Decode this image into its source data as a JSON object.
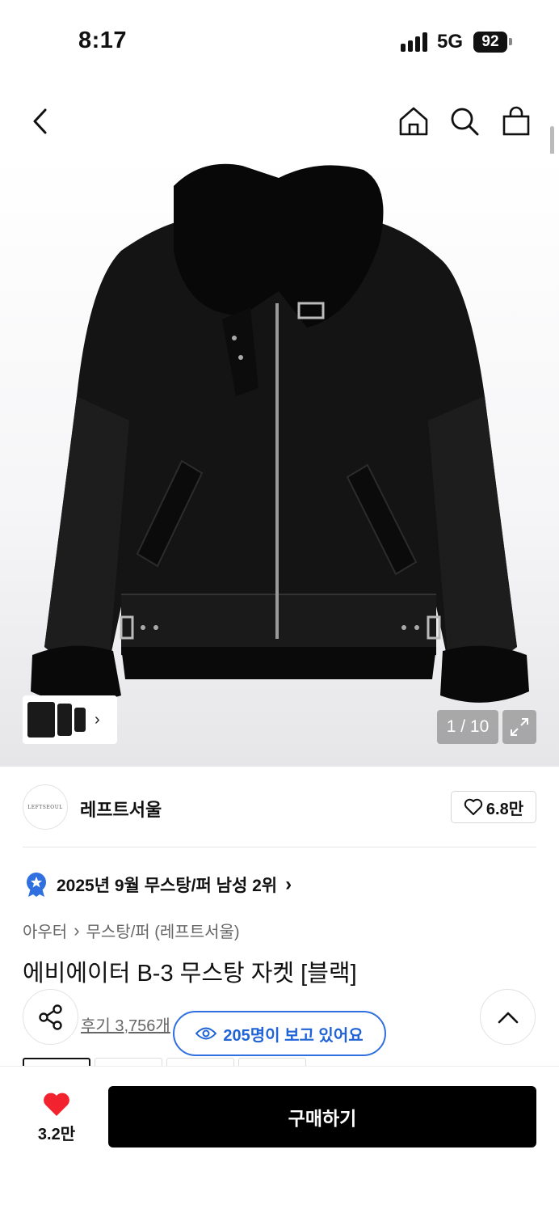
{
  "status": {
    "time": "8:17",
    "network": "5G",
    "battery": "92"
  },
  "nav": {
    "back_icon": "chevron-left-icon",
    "home_icon": "home-icon",
    "search_icon": "search-icon",
    "cart_icon": "shopping-bag-icon"
  },
  "gallery": {
    "counter": "1 / 10",
    "thumb_chevron": "›"
  },
  "brand": {
    "logo_text": "LEFTSEOUL",
    "name": "레프트서울",
    "likes": "6.8만"
  },
  "ranking": {
    "text": "2025년 9월 무스탕/퍼 남성 2위",
    "chevron": "›"
  },
  "breadcrumb": {
    "category": "아우터",
    "separator": "›",
    "subcategory": "무스탕/퍼 (레프트서울)"
  },
  "product": {
    "title": "에비에이터 B-3 무스탕 자켓 [블랙]",
    "reviews": "후기 3,756개"
  },
  "viewers": {
    "text": "205명이 보고 있어요"
  },
  "colors": {
    "accent_blue": "#2f6fe0",
    "heart_red": "#f2232f"
  },
  "bottom": {
    "wish_count": "3.2만",
    "buy_label": "구매하기"
  }
}
